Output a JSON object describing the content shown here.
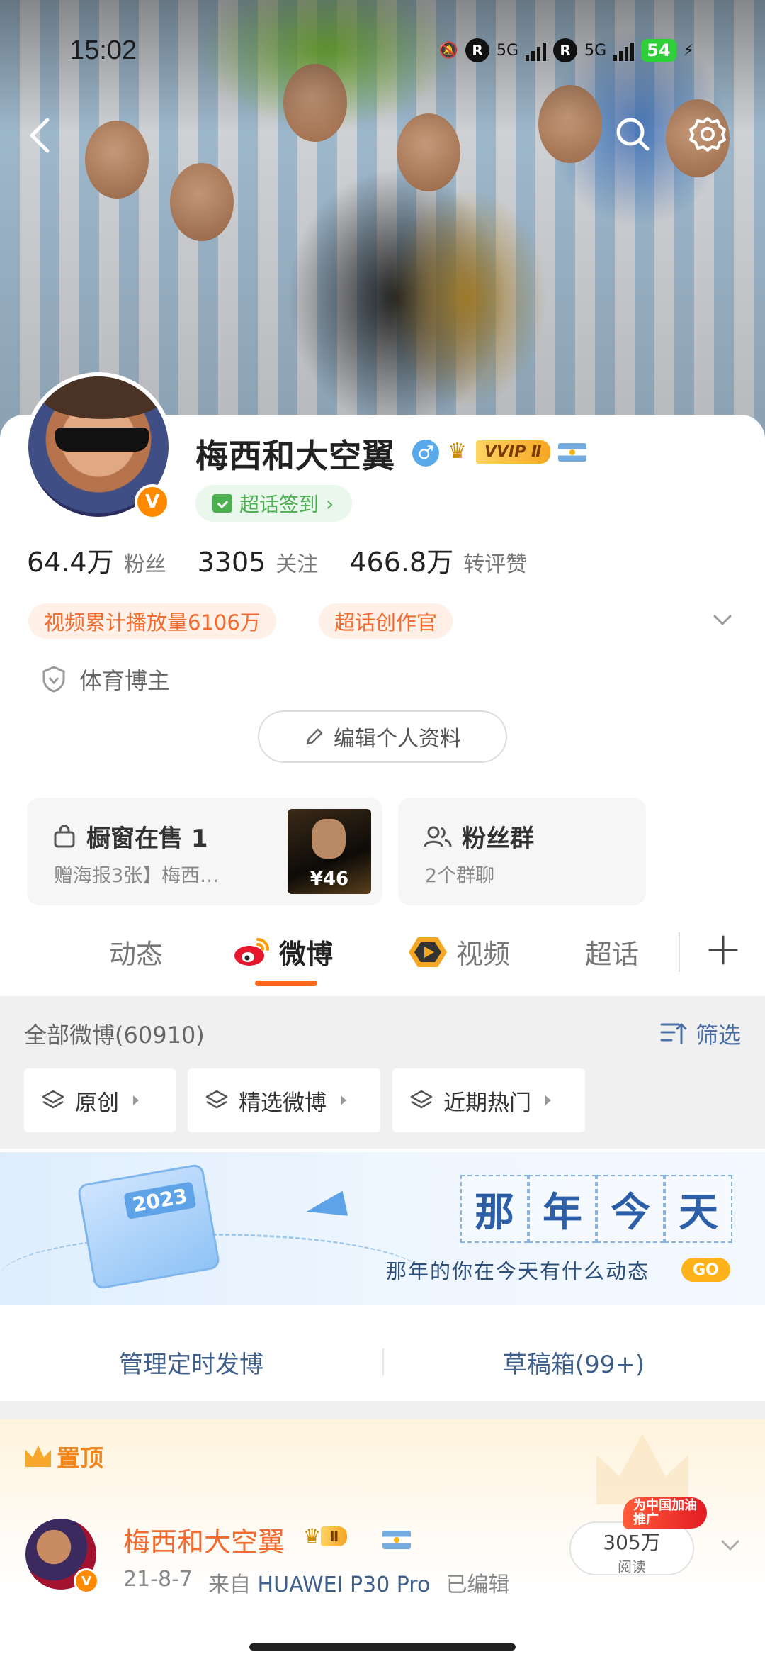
{
  "status_bar": {
    "time": "15:02",
    "net_a": "5G",
    "net_b": "5G",
    "battery": "54"
  },
  "profile": {
    "name": "梅西和大空翼",
    "gender_symbol": "♂",
    "vip_tag": "VVIP Ⅱ",
    "chaohua_label": "超话签到",
    "chaohua_arrow": "›",
    "verified_badge": "V",
    "stats": [
      {
        "num": "64.4万",
        "label": "粉丝"
      },
      {
        "num": "3305",
        "label": "关注"
      },
      {
        "num": "466.8万",
        "label": "转评赞"
      }
    ],
    "tags": [
      "视频累计播放量6106万",
      "超话创作官"
    ],
    "certification": "体育博主",
    "edit_button": "编辑个人资料"
  },
  "shop": {
    "title": "橱窗在售 1",
    "subtitle": "赠海报3张】梅西…",
    "price": "¥46"
  },
  "fans_group": {
    "title": "粉丝群",
    "subtitle": "2个群聊"
  },
  "tabs": [
    {
      "label": "动态"
    },
    {
      "label": "微博"
    },
    {
      "label": "视频"
    },
    {
      "label": "超话"
    }
  ],
  "filter": {
    "all_count": "全部微博(60910)",
    "sift_label": "筛选",
    "chips": [
      "原创",
      "精选微博",
      "近期热门"
    ]
  },
  "banner": {
    "year": "2023",
    "title_chars": [
      "那",
      "年",
      "今",
      "天"
    ],
    "subtitle": "那年的你在今天有什么动态",
    "go": "GO"
  },
  "manage": {
    "scheduled": "管理定时发博",
    "drafts": "草稿箱(99+)"
  },
  "pinned": {
    "label": "置顶",
    "author": "梅西和大空翼",
    "vip_tag": "Ⅱ",
    "date": "21-8-7",
    "source_prefix": "来自",
    "source": "HUAWEI P30 Pro",
    "edited": "已编辑",
    "reads_num": "305万",
    "reads_label": "阅读",
    "promo_line1": "为中国加油",
    "promo_line2": "推广"
  },
  "colors": {
    "accent": "#ff6a1a",
    "link": "#3e5f8a",
    "tag_text": "#f26a2e",
    "chaohua_green": "#4caf50"
  }
}
